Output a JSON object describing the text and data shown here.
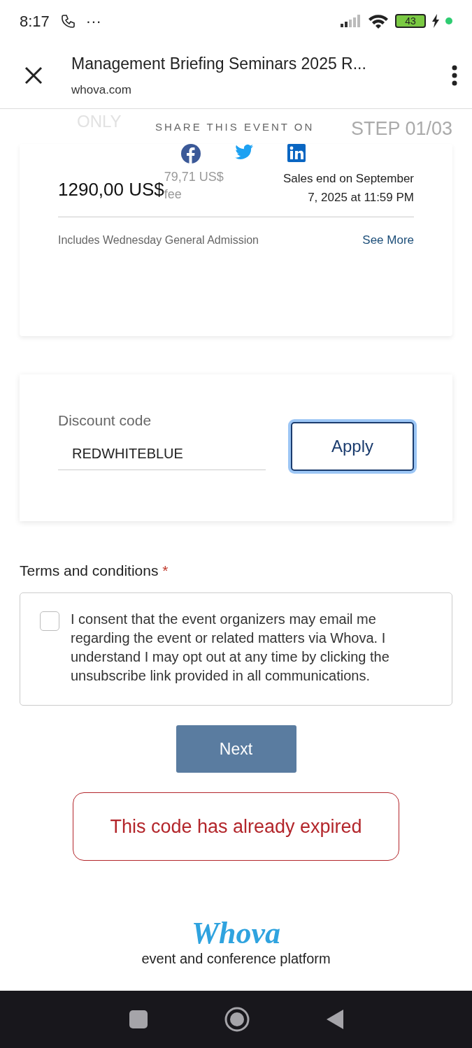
{
  "status_bar": {
    "time": "8:17",
    "more": "···",
    "battery": "43"
  },
  "browser_bar": {
    "title": "Management Briefing Seminars 2025 R...",
    "url": "whova.com"
  },
  "header_strip": {
    "faded_label": "ONLY",
    "share_label": "SHARE THIS EVENT ON",
    "step": "STEP 01/03"
  },
  "ticket": {
    "price": "1290,00 US$",
    "fee_amount": "79,71 US$",
    "fee_label": "fee",
    "sales_end": "Sales end on September 7, 2025 at 11:59 PM",
    "includes": "Includes Wednesday General Admission",
    "see_more": "See More"
  },
  "discount": {
    "label": "Discount code",
    "value": "REDWHITEBLUE",
    "apply": "Apply"
  },
  "terms": {
    "heading": "Terms and conditions",
    "required_mark": "*",
    "checked": false,
    "text": "I consent that the event organizers may email me regarding the event or related matters via Whova. I understand I may opt out at any time by clicking the unsubscribe link provided in all communications."
  },
  "next_button": {
    "label": "Next",
    "disabled": true
  },
  "error": "This code has already expired",
  "footer": {
    "logo": "Whova",
    "tagline": "event and conference platform"
  }
}
